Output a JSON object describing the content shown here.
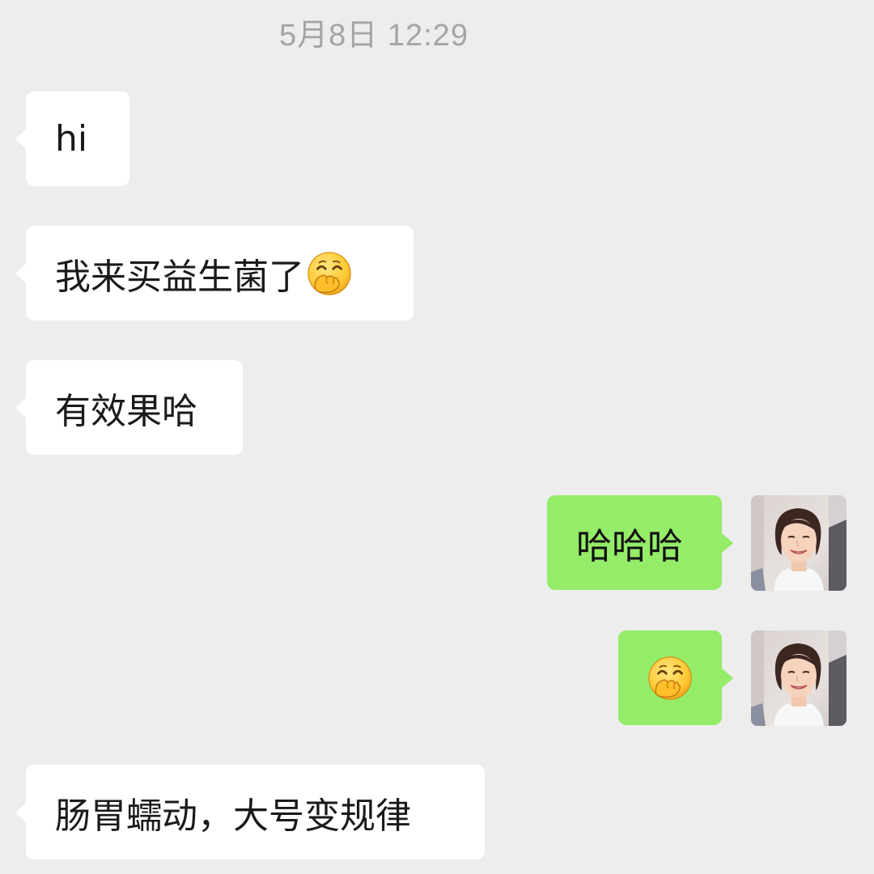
{
  "chat": {
    "timestamp": "5月8日 12:29",
    "messages": [
      {
        "side": "received",
        "text": "hi"
      },
      {
        "side": "received",
        "text": "我来买益生菌了",
        "trailing_icon": "hand-over-mouth-emoji"
      },
      {
        "side": "received",
        "text": "有效果哈"
      },
      {
        "side": "sent",
        "text": "哈哈哈",
        "avatar": "woman-avatar"
      },
      {
        "side": "sent",
        "text": "",
        "trailing_icon": "hand-over-mouth-emoji",
        "avatar": "woman-avatar"
      },
      {
        "side": "received",
        "text": "肠胃蠕动，大号变规律"
      }
    ]
  },
  "colors": {
    "background": "#ededed",
    "received_bubble": "#ffffff",
    "sent_bubble": "#95ec69",
    "timestamp_text": "#a5a5a5"
  }
}
